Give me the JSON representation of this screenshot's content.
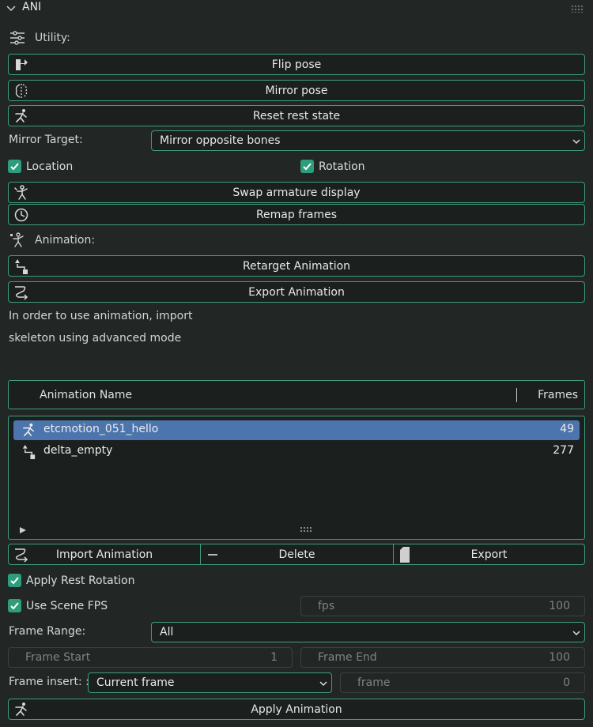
{
  "panel": {
    "title": "ANI"
  },
  "utility": {
    "label": "Utility:",
    "flip_pose": "Flip pose",
    "mirror_pose": "Mirror pose",
    "reset_rest": "Reset rest state",
    "mirror_target_label": "Mirror Target:",
    "mirror_target_value": "Mirror opposite bones",
    "location_label": "Location",
    "location_checked": true,
    "rotation_label": "Rotation",
    "rotation_checked": true,
    "swap_display": "Swap armature display",
    "remap_frames": "Remap frames"
  },
  "animation": {
    "label": "Animation:",
    "retarget": "Retarget Animation",
    "export": "Export Animation",
    "info_line1": "In order to use animation, import",
    "info_line2": "skeleton using advanced mode"
  },
  "list": {
    "col_name": "Animation Name",
    "col_frames": "Frames",
    "items": [
      {
        "name": "etcmotion_051_hello",
        "frames": "49",
        "selected": true,
        "icon": "pose-figure-icon"
      },
      {
        "name": "delta_empty",
        "frames": "277",
        "selected": false,
        "icon": "retarget-icon"
      }
    ]
  },
  "actions": {
    "import": "Import Animation",
    "delete": "Delete",
    "export": "Export"
  },
  "options": {
    "apply_rest_rotation": "Apply Rest Rotation",
    "use_scene_fps": "Use Scene FPS",
    "fps_label": "fps",
    "fps_value": "100",
    "frame_range_label": "Frame Range:",
    "frame_range_value": "All",
    "frame_start_label": "Frame Start",
    "frame_start_value": "1",
    "frame_end_label": "Frame End",
    "frame_end_value": "100",
    "frame_insert_label": "Frame insert: :",
    "frame_insert_value": "Current frame",
    "frame_label": "frame",
    "frame_value": "0",
    "apply_animation": "Apply Animation"
  },
  "colors": {
    "background": "#222726",
    "accent_border": "#3f9c80",
    "checkbox": "#2e9d7b",
    "selection": "#4c74ad"
  }
}
